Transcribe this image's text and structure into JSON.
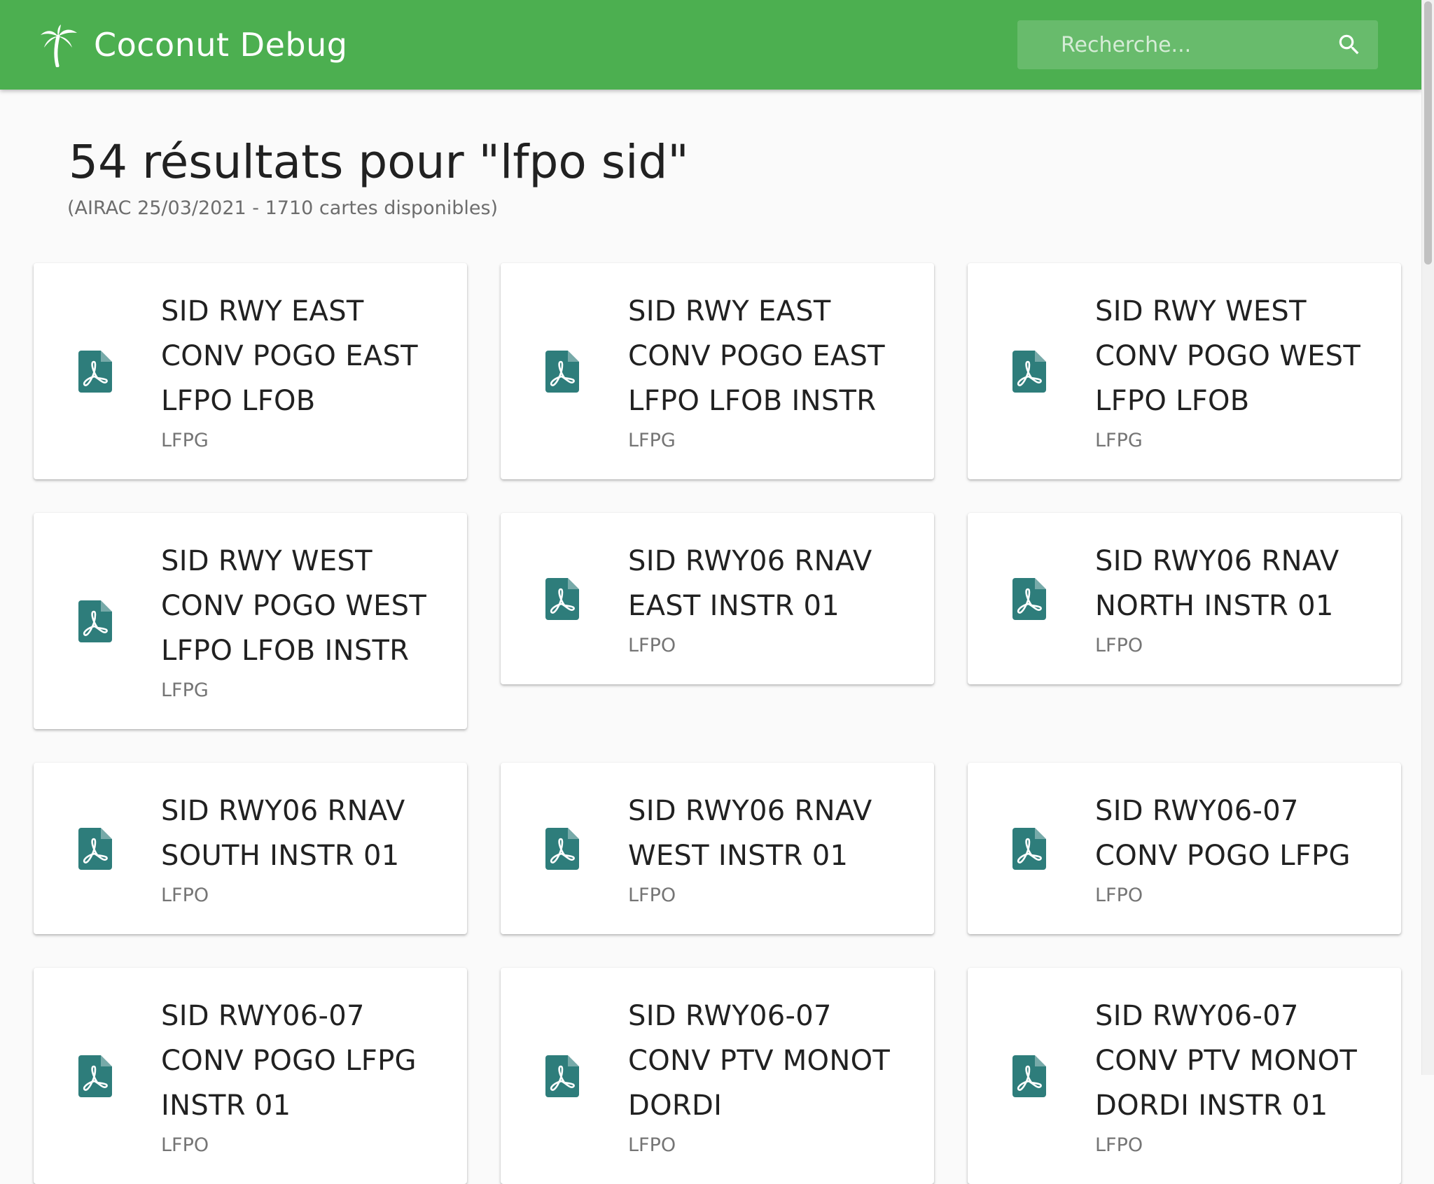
{
  "header": {
    "title": "Coconut Debug",
    "search": {
      "placeholder": "Recherche...",
      "value": ""
    },
    "colors": {
      "bar": "#4caf50",
      "text": "#ffffff"
    },
    "icons": [
      "palm-tree-icon",
      "search-icon"
    ]
  },
  "results": {
    "title": "54 résultats pour \"lfpo sid\"",
    "subtitle": "(AIRAC 25/03/2021 - 1710 cartes disponibles)"
  },
  "cards": [
    {
      "title": "SID RWY EAST CONV POGO EAST LFPO LFOB",
      "subtitle": "LFPG",
      "icon": "pdf-icon"
    },
    {
      "title": "SID RWY EAST CONV POGO EAST LFPO LFOB INSTR",
      "subtitle": "LFPG",
      "icon": "pdf-icon"
    },
    {
      "title": "SID RWY WEST CONV POGO WEST LFPO LFOB",
      "subtitle": "LFPG",
      "icon": "pdf-icon"
    },
    {
      "title": "SID RWY WEST CONV POGO WEST LFPO LFOB INSTR",
      "subtitle": "LFPG",
      "icon": "pdf-icon"
    },
    {
      "title": "SID RWY06 RNAV EAST INSTR 01",
      "subtitle": "LFPO",
      "icon": "pdf-icon"
    },
    {
      "title": "SID RWY06 RNAV NORTH INSTR 01",
      "subtitle": "LFPO",
      "icon": "pdf-icon"
    },
    {
      "title": "SID RWY06 RNAV SOUTH INSTR 01",
      "subtitle": "LFPO",
      "icon": "pdf-icon"
    },
    {
      "title": "SID RWY06 RNAV WEST INSTR 01",
      "subtitle": "LFPO",
      "icon": "pdf-icon"
    },
    {
      "title": "SID RWY06-07 CONV POGO LFPG",
      "subtitle": "LFPO",
      "icon": "pdf-icon"
    },
    {
      "title": "SID RWY06-07 CONV POGO LFPG INSTR 01",
      "subtitle": "LFPO",
      "icon": "pdf-icon"
    },
    {
      "title": "SID RWY06-07 CONV PTV MONOT DORDI",
      "subtitle": "LFPO",
      "icon": "pdf-icon"
    },
    {
      "title": "SID RWY06-07 CONV PTV MONOT DORDI INSTR 01",
      "subtitle": "LFPO",
      "icon": "pdf-icon"
    }
  ],
  "theme": {
    "icon_color": "#2e7d7b",
    "title_color": "#212121",
    "subtitle_color": "#757575"
  }
}
